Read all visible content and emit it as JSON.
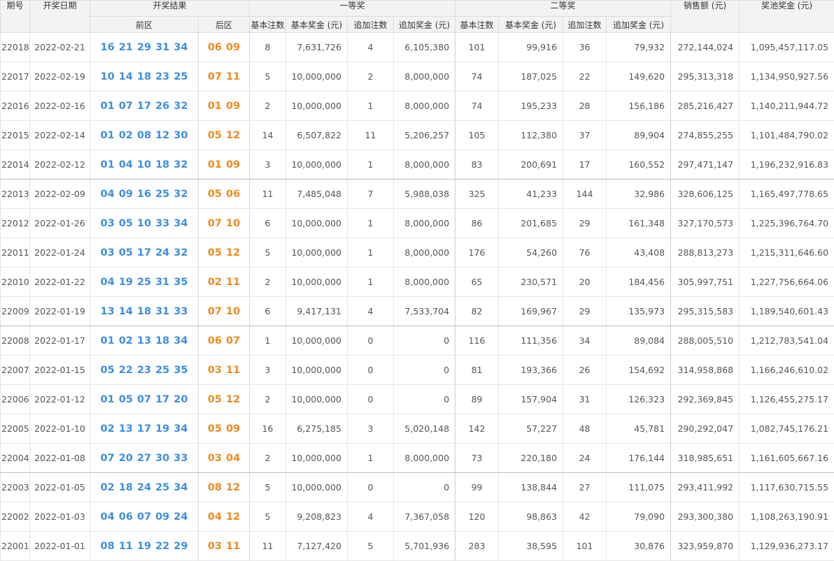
{
  "headers": {
    "issue": "期号",
    "date": "开奖日期",
    "result": "开奖结果",
    "front": "前区",
    "back": "后区",
    "first_prize": "一等奖",
    "second_prize": "二等奖",
    "base_count": "基本注数",
    "base_prize": "基本奖金 (元)",
    "extra_count": "追加注数",
    "extra_prize": "追加奖金 (元)",
    "sales": "销售额 (元)",
    "pool": "奖池奖金 (元)"
  },
  "rows": [
    {
      "issue": "22018",
      "date": "2022-02-21",
      "front": [
        "16",
        "21",
        "29",
        "31",
        "34"
      ],
      "back": [
        "06",
        "09"
      ],
      "p1_base_count": "8",
      "p1_base_prize": "7,631,726",
      "p1_extra_count": "4",
      "p1_extra_prize": "6,105,380",
      "p2_base_count": "101",
      "p2_base_prize": "99,916",
      "p2_extra_count": "36",
      "p2_extra_prize": "79,932",
      "sales": "272,144,024",
      "pool": "1,095,457,117.05"
    },
    {
      "issue": "22017",
      "date": "2022-02-19",
      "front": [
        "10",
        "14",
        "18",
        "23",
        "25"
      ],
      "back": [
        "07",
        "11"
      ],
      "p1_base_count": "5",
      "p1_base_prize": "10,000,000",
      "p1_extra_count": "2",
      "p1_extra_prize": "8,000,000",
      "p2_base_count": "74",
      "p2_base_prize": "187,025",
      "p2_extra_count": "22",
      "p2_extra_prize": "149,620",
      "sales": "295,313,318",
      "pool": "1,134,950,927.56"
    },
    {
      "issue": "22016",
      "date": "2022-02-16",
      "front": [
        "01",
        "07",
        "17",
        "26",
        "32"
      ],
      "back": [
        "01",
        "09"
      ],
      "p1_base_count": "2",
      "p1_base_prize": "10,000,000",
      "p1_extra_count": "1",
      "p1_extra_prize": "8,000,000",
      "p2_base_count": "74",
      "p2_base_prize": "195,233",
      "p2_extra_count": "28",
      "p2_extra_prize": "156,186",
      "sales": "285,216,427",
      "pool": "1,140,211,944.72"
    },
    {
      "issue": "22015",
      "date": "2022-02-14",
      "front": [
        "01",
        "02",
        "08",
        "12",
        "30"
      ],
      "back": [
        "05",
        "12"
      ],
      "p1_base_count": "14",
      "p1_base_prize": "6,507,822",
      "p1_extra_count": "11",
      "p1_extra_prize": "5,206,257",
      "p2_base_count": "105",
      "p2_base_prize": "112,380",
      "p2_extra_count": "37",
      "p2_extra_prize": "89,904",
      "sales": "274,855,255",
      "pool": "1,101,484,790.02"
    },
    {
      "issue": "22014",
      "date": "2022-02-12",
      "front": [
        "01",
        "04",
        "10",
        "18",
        "32"
      ],
      "back": [
        "01",
        "09"
      ],
      "p1_base_count": "3",
      "p1_base_prize": "10,000,000",
      "p1_extra_count": "1",
      "p1_extra_prize": "8,000,000",
      "p2_base_count": "83",
      "p2_base_prize": "200,691",
      "p2_extra_count": "17",
      "p2_extra_prize": "160,552",
      "sales": "297,471,147",
      "pool": "1,196,232,916.83"
    },
    {
      "issue": "22013",
      "date": "2022-02-09",
      "front": [
        "04",
        "09",
        "16",
        "25",
        "32"
      ],
      "back": [
        "05",
        "06"
      ],
      "p1_base_count": "11",
      "p1_base_prize": "7,485,048",
      "p1_extra_count": "7",
      "p1_extra_prize": "5,988,038",
      "p2_base_count": "325",
      "p2_base_prize": "41,233",
      "p2_extra_count": "144",
      "p2_extra_prize": "32,986",
      "sales": "328,606,125",
      "pool": "1,165,497,778.65"
    },
    {
      "issue": "22012",
      "date": "2022-01-26",
      "front": [
        "03",
        "05",
        "10",
        "33",
        "34"
      ],
      "back": [
        "07",
        "10"
      ],
      "p1_base_count": "6",
      "p1_base_prize": "10,000,000",
      "p1_extra_count": "1",
      "p1_extra_prize": "8,000,000",
      "p2_base_count": "86",
      "p2_base_prize": "201,685",
      "p2_extra_count": "29",
      "p2_extra_prize": "161,348",
      "sales": "327,170,573",
      "pool": "1,225,396,764.70"
    },
    {
      "issue": "22011",
      "date": "2022-01-24",
      "front": [
        "03",
        "05",
        "17",
        "24",
        "32"
      ],
      "back": [
        "05",
        "12"
      ],
      "p1_base_count": "5",
      "p1_base_prize": "10,000,000",
      "p1_extra_count": "1",
      "p1_extra_prize": "8,000,000",
      "p2_base_count": "176",
      "p2_base_prize": "54,260",
      "p2_extra_count": "76",
      "p2_extra_prize": "43,408",
      "sales": "288,813,273",
      "pool": "1,215,311,646.60"
    },
    {
      "issue": "22010",
      "date": "2022-01-22",
      "front": [
        "04",
        "19",
        "25",
        "31",
        "35"
      ],
      "back": [
        "02",
        "11"
      ],
      "p1_base_count": "2",
      "p1_base_prize": "10,000,000",
      "p1_extra_count": "1",
      "p1_extra_prize": "8,000,000",
      "p2_base_count": "65",
      "p2_base_prize": "230,571",
      "p2_extra_count": "20",
      "p2_extra_prize": "184,456",
      "sales": "305,997,751",
      "pool": "1,227,756,664.06"
    },
    {
      "issue": "22009",
      "date": "2022-01-19",
      "front": [
        "13",
        "14",
        "18",
        "31",
        "33"
      ],
      "back": [
        "07",
        "10"
      ],
      "p1_base_count": "6",
      "p1_base_prize": "9,417,131",
      "p1_extra_count": "4",
      "p1_extra_prize": "7,533,704",
      "p2_base_count": "82",
      "p2_base_prize": "169,967",
      "p2_extra_count": "29",
      "p2_extra_prize": "135,973",
      "sales": "295,315,583",
      "pool": "1,189,540,601.43"
    },
    {
      "issue": "22008",
      "date": "2022-01-17",
      "front": [
        "01",
        "02",
        "13",
        "18",
        "34"
      ],
      "back": [
        "06",
        "07"
      ],
      "p1_base_count": "1",
      "p1_base_prize": "10,000,000",
      "p1_extra_count": "0",
      "p1_extra_prize": "0",
      "p2_base_count": "116",
      "p2_base_prize": "111,356",
      "p2_extra_count": "34",
      "p2_extra_prize": "89,084",
      "sales": "288,005,510",
      "pool": "1,212,783,541.04"
    },
    {
      "issue": "22007",
      "date": "2022-01-15",
      "front": [
        "05",
        "22",
        "23",
        "25",
        "35"
      ],
      "back": [
        "03",
        "11"
      ],
      "p1_base_count": "3",
      "p1_base_prize": "10,000,000",
      "p1_extra_count": "0",
      "p1_extra_prize": "0",
      "p2_base_count": "81",
      "p2_base_prize": "193,366",
      "p2_extra_count": "26",
      "p2_extra_prize": "154,692",
      "sales": "314,958,868",
      "pool": "1,166,246,610.02"
    },
    {
      "issue": "22006",
      "date": "2022-01-12",
      "front": [
        "01",
        "05",
        "07",
        "17",
        "20"
      ],
      "back": [
        "05",
        "12"
      ],
      "p1_base_count": "2",
      "p1_base_prize": "10,000,000",
      "p1_extra_count": "0",
      "p1_extra_prize": "0",
      "p2_base_count": "89",
      "p2_base_prize": "157,904",
      "p2_extra_count": "31",
      "p2_extra_prize": "126,323",
      "sales": "292,369,845",
      "pool": "1,126,455,275.17"
    },
    {
      "issue": "22005",
      "date": "2022-01-10",
      "front": [
        "02",
        "13",
        "17",
        "19",
        "34"
      ],
      "back": [
        "05",
        "09"
      ],
      "p1_base_count": "16",
      "p1_base_prize": "6,275,185",
      "p1_extra_count": "3",
      "p1_extra_prize": "5,020,148",
      "p2_base_count": "142",
      "p2_base_prize": "57,227",
      "p2_extra_count": "48",
      "p2_extra_prize": "45,781",
      "sales": "290,292,047",
      "pool": "1,082,745,176.21"
    },
    {
      "issue": "22004",
      "date": "2022-01-08",
      "front": [
        "07",
        "20",
        "27",
        "30",
        "33"
      ],
      "back": [
        "03",
        "04"
      ],
      "p1_base_count": "2",
      "p1_base_prize": "10,000,000",
      "p1_extra_count": "1",
      "p1_extra_prize": "8,000,000",
      "p2_base_count": "73",
      "p2_base_prize": "220,180",
      "p2_extra_count": "24",
      "p2_extra_prize": "176,144",
      "sales": "318,985,651",
      "pool": "1,161,605,667.16"
    },
    {
      "issue": "22003",
      "date": "2022-01-05",
      "front": [
        "02",
        "18",
        "24",
        "25",
        "34"
      ],
      "back": [
        "08",
        "12"
      ],
      "p1_base_count": "5",
      "p1_base_prize": "10,000,000",
      "p1_extra_count": "0",
      "p1_extra_prize": "0",
      "p2_base_count": "99",
      "p2_base_prize": "138,844",
      "p2_extra_count": "27",
      "p2_extra_prize": "111,075",
      "sales": "293,411,992",
      "pool": "1,117,630,715.55"
    },
    {
      "issue": "22002",
      "date": "2022-01-03",
      "front": [
        "04",
        "06",
        "07",
        "09",
        "24"
      ],
      "back": [
        "04",
        "12"
      ],
      "p1_base_count": "5",
      "p1_base_prize": "9,208,823",
      "p1_extra_count": "4",
      "p1_extra_prize": "7,367,058",
      "p2_base_count": "120",
      "p2_base_prize": "98,863",
      "p2_extra_count": "42",
      "p2_extra_prize": "79,090",
      "sales": "293,300,380",
      "pool": "1,108,263,190.91"
    },
    {
      "issue": "22001",
      "date": "2022-01-01",
      "front": [
        "08",
        "11",
        "19",
        "22",
        "29"
      ],
      "back": [
        "03",
        "11"
      ],
      "p1_base_count": "11",
      "p1_base_prize": "7,127,420",
      "p1_extra_count": "5",
      "p1_extra_prize": "5,701,936",
      "p2_base_count": "283",
      "p2_base_prize": "38,595",
      "p2_extra_count": "101",
      "p2_extra_prize": "30,876",
      "sales": "323,959,870",
      "pool": "1,129,936,273.17"
    }
  ],
  "colors": {
    "front_ball": "#3d8ee0",
    "back_ball": "#f08a1c",
    "header_bg": "#f3f3f3"
  }
}
